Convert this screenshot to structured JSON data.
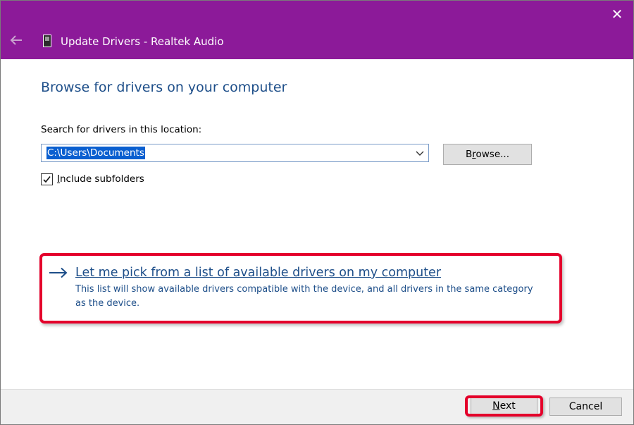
{
  "window": {
    "title": "Update Drivers - Realtek Audio",
    "close_glyph": "✕",
    "title_color": "#8c1a99"
  },
  "main": {
    "heading": "Browse for drivers on your computer",
    "search_label": "Search for drivers in this location:",
    "path_value": "C:\\Users\\Documents",
    "browse_label_pre": "B",
    "browse_label_accel": "r",
    "browse_label_post": "owse...",
    "include_subfolders_pre": "",
    "include_subfolders_accel": "I",
    "include_subfolders_post": "nclude subfolders",
    "include_subfolders_checked": true,
    "pick_link_pre": "",
    "pick_link_accel": "L",
    "pick_link_post": "et me pick from a list of available drivers on my computer",
    "pick_link_description": "This list will show available drivers compatible with the device, and all drivers in the same category as the device."
  },
  "footer": {
    "next_accel": "N",
    "next_post": "ext",
    "cancel_label": "Cancel"
  },
  "icons": {
    "back": "back-arrow-icon",
    "device": "device-icon",
    "close": "close-icon",
    "dropdown": "chevron-down-icon",
    "checkmark": "checkmark-icon",
    "link_arrow": "right-arrow-icon"
  },
  "colors": {
    "accent_purple": "#8c1a99",
    "link_blue": "#1d4e89",
    "highlight_red": "#e4002b",
    "selection_blue": "#0a5fd0"
  }
}
